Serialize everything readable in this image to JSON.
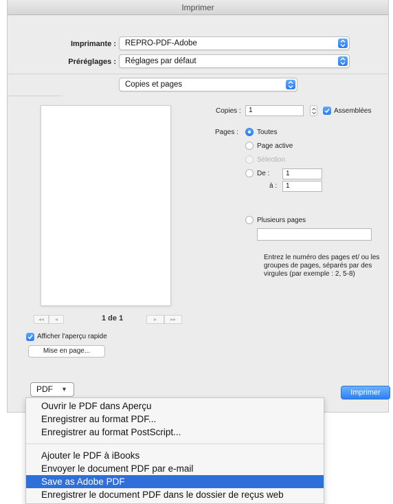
{
  "window": {
    "title": "Imprimer"
  },
  "printer": {
    "label": "Imprimante :",
    "value": "REPRO-PDF-Adobe"
  },
  "presets": {
    "label": "Préréglages :",
    "value": "Réglages par défaut"
  },
  "section": {
    "value": "Copies et pages"
  },
  "preview": {
    "page_indicator": "1 de 1",
    "first": "◂◂",
    "prev": "◂",
    "next": "▸",
    "last": "▸▸"
  },
  "quick_preview": {
    "label": "Afficher l'aperçu rapide",
    "checked": true
  },
  "page_setup": {
    "label": "Mise en page..."
  },
  "copies": {
    "label": "Copies :",
    "value": "1",
    "collate_label": "Assemblées",
    "collate_checked": true
  },
  "pages": {
    "label": "Pages :",
    "all": "Toutes",
    "current": "Page active",
    "selection": "Sélection",
    "from_label": "De :",
    "from_value": "1",
    "to_label": "à :",
    "to_value": "1",
    "multiple": "Plusieurs pages",
    "multiple_value": "",
    "hint": "Entrez le numéro des pages et/ ou les groupes de pages, séparés par des virgules (par exemple : 2, 5-8)"
  },
  "pdf_button": {
    "label": "PDF",
    "arrow": "▼"
  },
  "print_button": {
    "label": "Imprimer"
  },
  "pdf_menu": {
    "items": [
      "Ouvrir le PDF dans Aperçu",
      "Enregistrer au format PDF...",
      "Enregistrer au format PostScript...",
      "Ajouter le PDF à iBooks",
      "Envoyer le document PDF par e-mail",
      "Save as Adobe PDF",
      "Enregistrer le document PDF dans le dossier de reçus web"
    ],
    "selected_index": 5
  },
  "colors": {
    "accent": "#2b7cf2",
    "menu_highlight": "#2f6fd9",
    "dialog_bg": "#ececec"
  }
}
